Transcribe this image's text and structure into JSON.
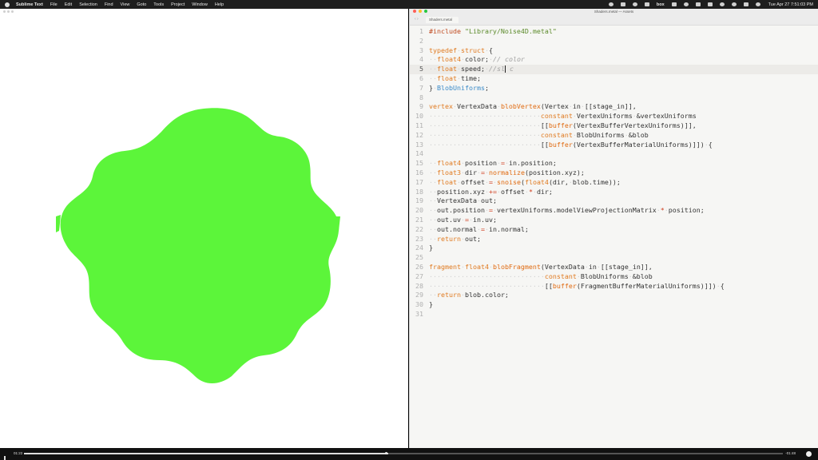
{
  "menubar": {
    "app": "Sublime Text",
    "items": [
      "File",
      "Edit",
      "Selection",
      "Find",
      "View",
      "Goto",
      "Tools",
      "Project",
      "Window",
      "Help"
    ],
    "status_box": "box",
    "clock": "Tue Apr 27  7:51:03 PM"
  },
  "preview": {
    "blob_color": "#5cf53a"
  },
  "editor": {
    "window_title": "Shaders.metal — Assets",
    "tab_label": "Shaders.metal",
    "nav_arrows": "‹ ›",
    "current_line": 5,
    "lines": [
      "#include \"Library/Noise4D.metal\"",
      "",
      "typedef struct {",
      "  float4 color; // color",
      "  float speed; //sl c",
      "  float time;",
      "} BlobUniforms;",
      "",
      "vertex VertexData blobVertex(Vertex in [[stage_in]],",
      "                            constant VertexUniforms &vertexUniforms",
      "                            [[buffer(VertexBufferVertexUniforms)]],",
      "                            constant BlobUniforms &blob",
      "                            [[buffer(VertexBufferMaterialUniforms)]]) {",
      "",
      "  float4 position = in.position;",
      "  float3 dir = normalize(position.xyz);",
      "  float offset = snoise(float4(dir, blob.time));",
      "  position.xyz += offset * dir;",
      "  VertexData out;",
      "  out.position = vertexUniforms.modelViewProjectionMatrix * position;",
      "  out.uv = in.uv;",
      "  out.normal = in.normal;",
      "  return out;",
      "}",
      "",
      "fragment float4 blobFragment(VertexData in [[stage_in]],",
      "                             constant BlobUniforms &blob",
      "                             [[buffer(FragmentBufferMaterialUniforms)]]) {",
      "  return blob.color;",
      "}",
      ""
    ]
  },
  "videobar": {
    "elapsed": "01:22",
    "remaining": "-01:48",
    "progress": 0.48
  }
}
